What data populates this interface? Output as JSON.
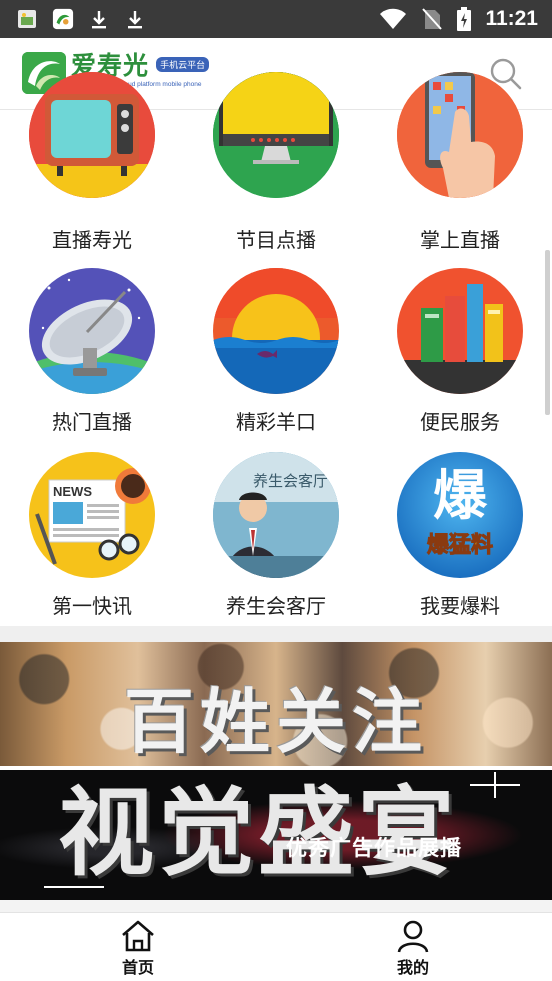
{
  "status_bar": {
    "time": "11:21",
    "left_icons": [
      "gallery-app-icon",
      "app-notification-icon",
      "download-icon",
      "download-icon"
    ],
    "right_icons": [
      "wifi-icon",
      "no-sim-icon",
      "battery-charging-icon"
    ]
  },
  "header": {
    "logo_name": "爱寿光",
    "logo_badge": "手机云平台",
    "logo_tagline": "Shouguang love cloud platform mobile phone",
    "search_icon": "search-icon"
  },
  "grid": {
    "items": [
      {
        "label": "直播寿光",
        "icon": "tv-icon"
      },
      {
        "label": "节目点播",
        "icon": "monitor-icon"
      },
      {
        "label": "掌上直播",
        "icon": "phone-hand-icon"
      },
      {
        "label": "热门直播",
        "icon": "satellite-dish-icon"
      },
      {
        "label": "精彩羊口",
        "icon": "sunset-sea-icon"
      },
      {
        "label": "便民服务",
        "icon": "books-icon"
      },
      {
        "label": "第一快讯",
        "icon": "newspaper-icon"
      },
      {
        "label": "养生会客厅",
        "icon": "host-photo-icon"
      },
      {
        "label": "我要爆料",
        "icon": "baoliao-icon",
        "badge_big": "爆",
        "badge_small": "爆猛料"
      }
    ],
    "host_photo_text": "养生会客厅"
  },
  "banners": {
    "first_title": "百姓关注",
    "second_title": "视觉盛宴",
    "second_subtitle": "优秀广告作品展播"
  },
  "bottom_nav": {
    "items": [
      {
        "label": "首页",
        "icon": "home-icon"
      },
      {
        "label": "我的",
        "icon": "user-icon"
      }
    ]
  },
  "colors": {
    "status_bar_bg": "#3a3a3a",
    "logo_green": "#2d8f3c",
    "logo_blue": "#3a63b8"
  }
}
